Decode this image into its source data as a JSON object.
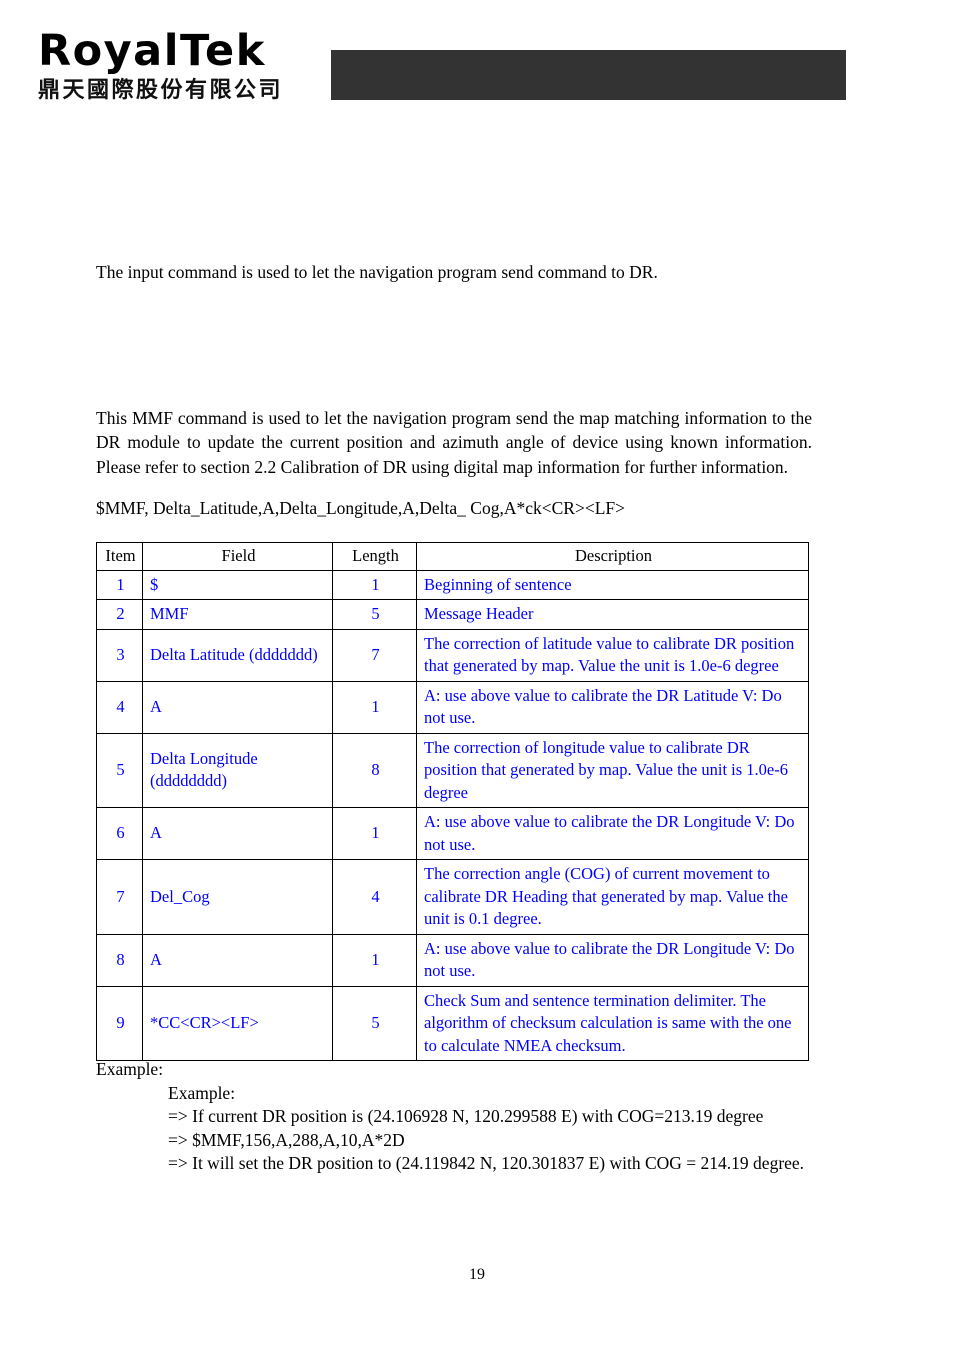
{
  "header": {
    "logo_wordmark": "RoyalTek",
    "logo_subtitle": "鼎天國際股份有限公司",
    "bar_color": "#333333"
  },
  "body": {
    "intro_paragraph": "The input command is used to let the navigation program send command to DR.",
    "mmf_paragraph": "This MMF command is used to let the navigation program send the map matching information to the DR module to update the current position and azimuth angle of device using known information. Please refer to section 2.2 Calibration of DR using digital map information for further information.",
    "syntax": "$MMF, Delta_Latitude,A,Delta_Longitude,A,Delta_ Cog,A*ck<CR><LF>"
  },
  "table": {
    "headers": [
      "Item",
      "Field",
      "Length",
      "Description"
    ],
    "text_color": "#0000FF",
    "rows": [
      {
        "item": "1",
        "field": "$",
        "length": "1",
        "description": "Beginning of sentence"
      },
      {
        "item": "2",
        "field": "MMF",
        "length": "5",
        "description": "Message Header"
      },
      {
        "item": "3",
        "field": "Delta Latitude (ddddddd)",
        "length": "7",
        "description": "The correction of latitude value to calibrate DR position that generated by map. Value the unit is 1.0e-6 degree"
      },
      {
        "item": "4",
        "field": "A",
        "length": "1",
        "description": "A: use above value to calibrate the DR Latitude V: Do not use."
      },
      {
        "item": "5",
        "field": "Delta Longitude (dddddddd)",
        "length": "8",
        "description": "The correction of longitude value to calibrate DR position that generated by map. Value the unit is 1.0e-6 degree"
      },
      {
        "item": "6",
        "field": "A",
        "length": "1",
        "description": "A: use above value to calibrate the DR Longitude V: Do not use."
      },
      {
        "item": "7",
        "field": "Del_Cog",
        "length": "4",
        "description": "The correction angle (COG) of current movement to calibrate DR Heading that generated by map. Value the unit is 0.1 degree."
      },
      {
        "item": "8",
        "field": "A",
        "length": "1",
        "description": "A: use above value to calibrate the DR Longitude V: Do not use."
      },
      {
        "item": "9",
        "field": "*CC<CR><LF>",
        "length": "5",
        "description": "Check Sum and sentence termination delimiter. The algorithm of checksum calculation is same with the one to calculate NMEA checksum."
      }
    ]
  },
  "example": {
    "label": "Example:",
    "lines": [
      "Example:",
      "=> If current DR position is (24.106928 N, 120.299588 E) with COG=213.19 degree",
      "=> $MMF,156,A,288,A,10,A*2D",
      "=> It will set the DR position to (24.119842 N, 120.301837 E) with COG = 214.19 degree."
    ]
  },
  "footer": {
    "page_number": "19"
  }
}
